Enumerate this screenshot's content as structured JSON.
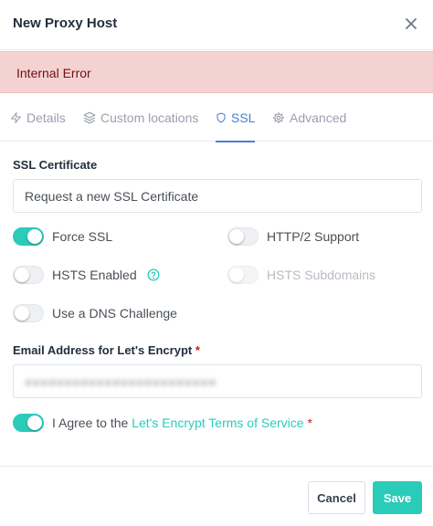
{
  "modal": {
    "title": "New Proxy Host",
    "close_label": "×"
  },
  "alert": {
    "message": "Internal Error",
    "color": "#f5d2d2"
  },
  "tabs": [
    {
      "label": "Details",
      "icon": "zap-icon",
      "active": false
    },
    {
      "label": "Custom locations",
      "icon": "layers-icon",
      "active": false
    },
    {
      "label": "SSL",
      "icon": "shield-icon",
      "active": true
    },
    {
      "label": "Advanced",
      "icon": "gear-icon",
      "active": false
    }
  ],
  "ssl": {
    "certificate_label": "SSL Certificate",
    "certificate_value": "Request a new SSL Certificate",
    "toggles": {
      "force_ssl": {
        "label": "Force SSL",
        "on": true
      },
      "http2": {
        "label": "HTTP/2 Support",
        "on": false
      },
      "hsts": {
        "label": "HSTS Enabled",
        "on": false,
        "help_icon": "help-circle-icon"
      },
      "hsts_sub": {
        "label": "HSTS Subdomains",
        "on": false,
        "disabled": true
      },
      "dns": {
        "label": "Use a DNS Challenge",
        "on": false
      }
    },
    "email_label": "Email Address for Let's Encrypt",
    "email_value": "●●●●●●●●●●●●●●●●●●●●●●●●",
    "agree_prefix": "I Agree to the",
    "agree_link": "Let's Encrypt Terms of Service",
    "agree_on": true,
    "required_mark": "*"
  },
  "footer": {
    "cancel_label": "Cancel",
    "save_label": "Save"
  },
  "colors": {
    "accent": "#2bcbba",
    "tab_active": "#467fcf",
    "required": "#cd201f"
  }
}
